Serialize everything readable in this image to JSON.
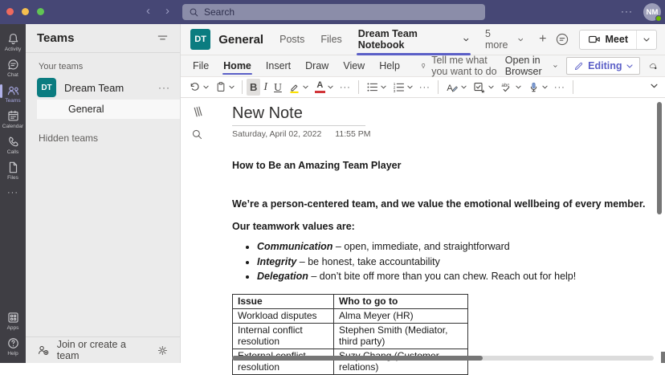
{
  "titlebar": {
    "search_placeholder": "Search",
    "back": "‹",
    "forward": "›",
    "more": "···",
    "avatar_initials": "NM"
  },
  "rail": {
    "items": [
      {
        "label": "Activity"
      },
      {
        "label": "Chat"
      },
      {
        "label": "Teams"
      },
      {
        "label": "Calendar"
      },
      {
        "label": "Calls"
      },
      {
        "label": "Files"
      }
    ],
    "more": "···",
    "bottom": [
      {
        "label": "Apps"
      },
      {
        "label": "Help"
      }
    ]
  },
  "sidebar": {
    "title": "Teams",
    "your_teams": "Your teams",
    "team_initials": "DT",
    "team_name": "Dream Team",
    "team_more": "···",
    "channel": "General",
    "hidden_teams": "Hidden teams",
    "join": "Join or create a team"
  },
  "header": {
    "avatar_initials": "DT",
    "title": "General",
    "tab_posts": "Posts",
    "tab_files": "Files",
    "tab_notebook": "Dream Team Notebook",
    "tab_more": "5 more",
    "tab_add": "+",
    "meet": "Meet"
  },
  "ribbon": {
    "file": "File",
    "home": "Home",
    "insert": "Insert",
    "draw": "Draw",
    "view": "View",
    "help": "Help",
    "tellme": "Tell me what you want to do",
    "open_in_browser": "Open in Browser",
    "editing": "Editing"
  },
  "toolbar": {
    "bold": "B",
    "italic": "I",
    "underline": "U",
    "more": "···"
  },
  "note": {
    "title": "New Note",
    "date": "Saturday, April 02, 2022",
    "time": "11:55 PM",
    "heading": "How to Be an Amazing Team Player",
    "para1": "We’re a person-centered team, and we value the emotional wellbeing of every member.",
    "para2": "Our teamwork values are:",
    "bullets": [
      {
        "term": "Communication",
        "text": " – open, immediate, and straightforward"
      },
      {
        "term": "Integrity",
        "text": " – be honest, take accountability"
      },
      {
        "term": "Delegation",
        "text": " – don’t bite off more than you can chew. Reach out for help!"
      }
    ],
    "table": {
      "headers": [
        "Issue",
        "Who to go to"
      ],
      "rows": [
        [
          "Workload disputes",
          "Alma Meyer (HR)"
        ],
        [
          "Internal conflict resolution",
          "Stephen Smith (Mediator, third party)"
        ],
        [
          "External conflict resolution",
          "Suzy Chang (Customer relations)"
        ]
      ]
    }
  },
  "colors": {
    "accent": "#5b5fc7",
    "titlebar": "#464775",
    "team_avatar_teal": "#0b7c80",
    "highlight_yellow": "#fce100",
    "font_color_red": "#d13438",
    "presence_green": "#6bb700"
  }
}
